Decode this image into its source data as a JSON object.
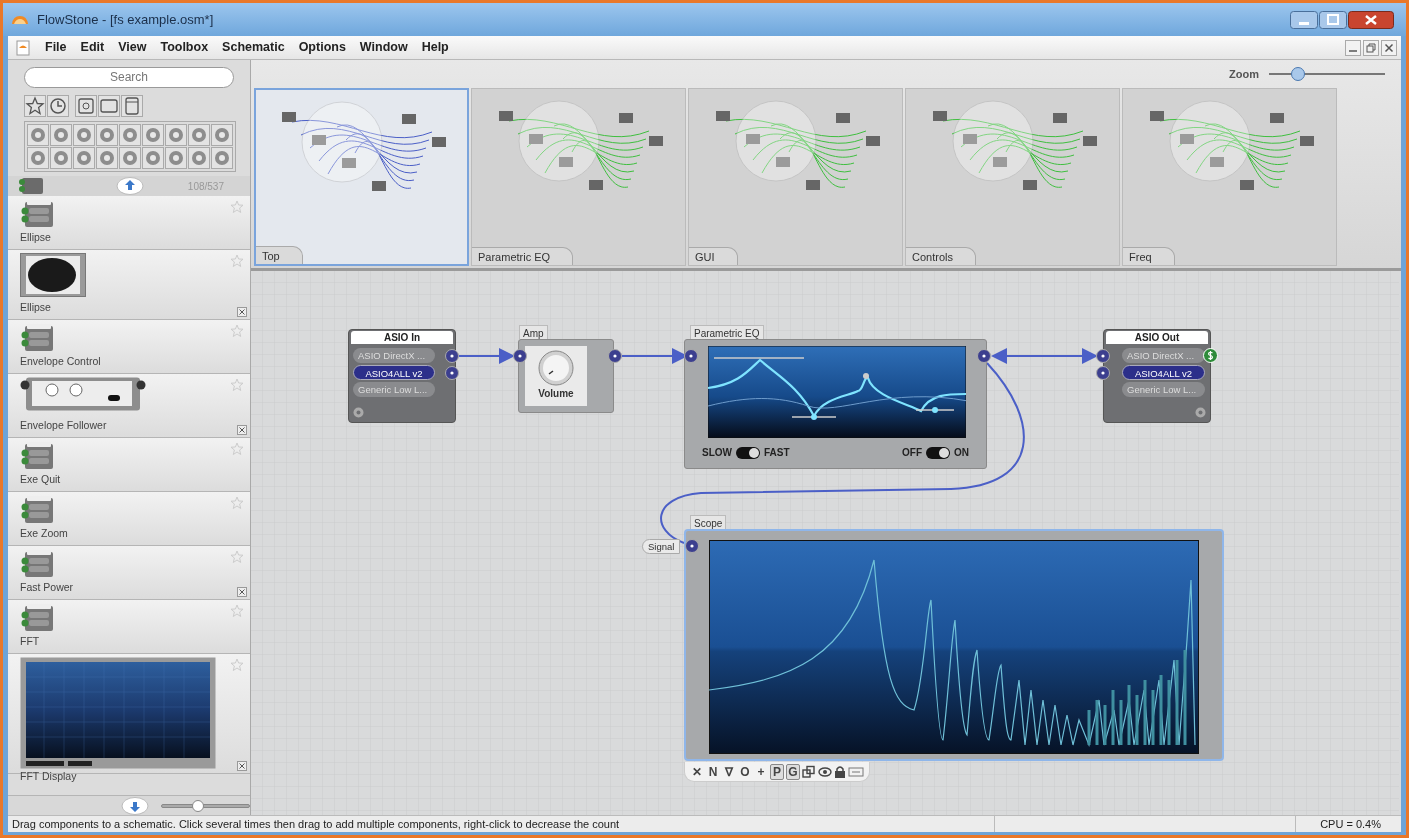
{
  "window": {
    "title": "FlowStone - [fs example.osm*]"
  },
  "menu": [
    "File",
    "Edit",
    "View",
    "Toolbox",
    "Schematic",
    "Options",
    "Window",
    "Help"
  ],
  "toolbox": {
    "search": {
      "placeholder": "Search"
    },
    "count": "108/537",
    "size_slider": {
      "level": 0.4
    },
    "components": [
      {
        "name": "Ellipse",
        "kind": "module",
        "closable": false
      },
      {
        "name": "Ellipse",
        "kind": "ellipse",
        "closable": true
      },
      {
        "name": "Envelope Control",
        "kind": "module",
        "closable": false
      },
      {
        "name": "Envelope Follower",
        "kind": "envelope",
        "closable": true
      },
      {
        "name": "Exe Quit",
        "kind": "module",
        "closable": false
      },
      {
        "name": "Exe Zoom",
        "kind": "module",
        "closable": false
      },
      {
        "name": "Fast Power",
        "kind": "module",
        "closable": true
      },
      {
        "name": "FFT",
        "kind": "module",
        "closable": false
      },
      {
        "name": "FFT Display",
        "kind": "display",
        "closable": true
      }
    ]
  },
  "navigator": {
    "zoom_label": "Zoom",
    "zoom_slider": {
      "level": 0.22
    },
    "pages": [
      {
        "label": "Top",
        "selected": true
      },
      {
        "label": "Parametric EQ",
        "selected": false
      },
      {
        "label": "GUI",
        "selected": false
      },
      {
        "label": "Controls",
        "selected": false
      },
      {
        "label": "Freq",
        "selected": false
      }
    ]
  },
  "schematic": {
    "asio_in": {
      "title": "ASIO In",
      "options": [
        {
          "label": "ASIO DirectX ...",
          "selected": false
        },
        {
          "label": "ASIO4ALL v2",
          "selected": true
        },
        {
          "label": "Generic Low L...",
          "selected": false
        }
      ]
    },
    "amp": {
      "title": "Amp",
      "knob_label": "Volume"
    },
    "eq": {
      "title": "Parametric EQ",
      "toggles": [
        {
          "off_label": "SLOW",
          "on_label": "FAST",
          "on": true
        },
        {
          "off_label": "OFF",
          "on_label": "ON",
          "on": true
        }
      ]
    },
    "asio_out": {
      "title": "ASIO Out",
      "options": [
        {
          "label": "ASIO DirectX ...",
          "selected": false
        },
        {
          "label": "ASIO4ALL v2",
          "selected": true
        },
        {
          "label": "Generic Low L...",
          "selected": false
        }
      ]
    },
    "scope": {
      "title": "Scope",
      "input_label": "Signal"
    },
    "toolbar": [
      {
        "kind": "glyph",
        "text": "✕",
        "pressed": false
      },
      {
        "kind": "glyph",
        "text": "N",
        "pressed": false
      },
      {
        "kind": "glyph",
        "text": "∇",
        "pressed": false
      },
      {
        "kind": "glyph",
        "text": "O",
        "pressed": false
      },
      {
        "kind": "glyph",
        "text": "+",
        "pressed": false
      },
      {
        "kind": "glyph",
        "text": "P",
        "pressed": true
      },
      {
        "kind": "glyph",
        "text": "G",
        "pressed": true
      },
      {
        "kind": "icon",
        "pressed": false
      }
    ]
  },
  "status_bar": {
    "message": "Drag components to a schematic. Click several times then drag to add multiple components, right-click to decrease the count",
    "cpu": "CPU = 0.4%"
  }
}
